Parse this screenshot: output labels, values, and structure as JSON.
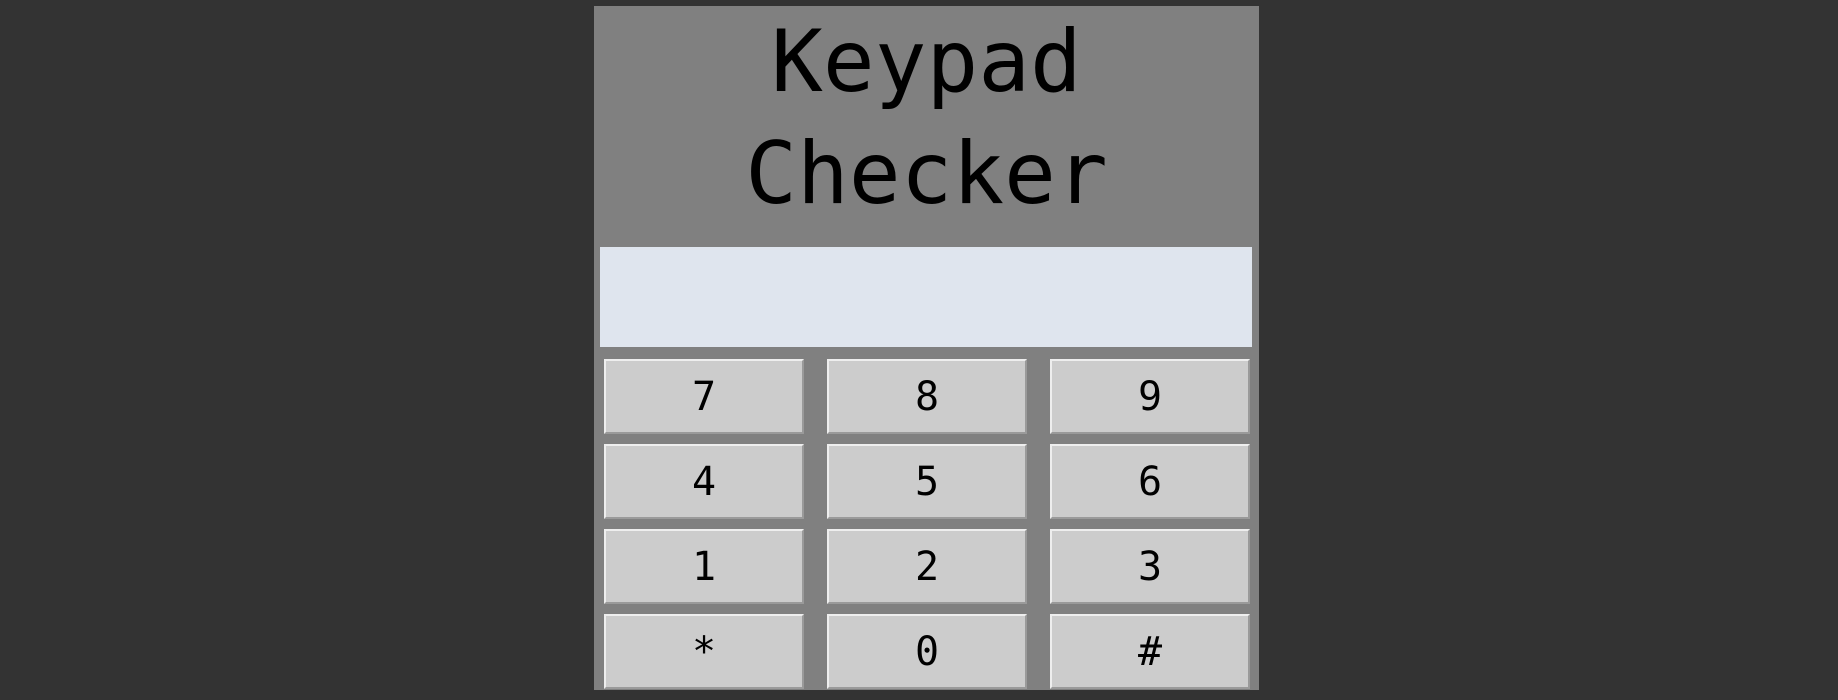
{
  "app": {
    "title_line1": "Keypad",
    "title_line2": "Checker"
  },
  "display": {
    "value": ""
  },
  "keypad": {
    "keys": [
      "7",
      "8",
      "9",
      "4",
      "5",
      "6",
      "1",
      "2",
      "3",
      "*",
      "0",
      "#"
    ]
  },
  "colors": {
    "page_background": "#333333",
    "panel_background": "#808080",
    "display_background": "#dfe5ee",
    "key_background": "#cccccc"
  }
}
